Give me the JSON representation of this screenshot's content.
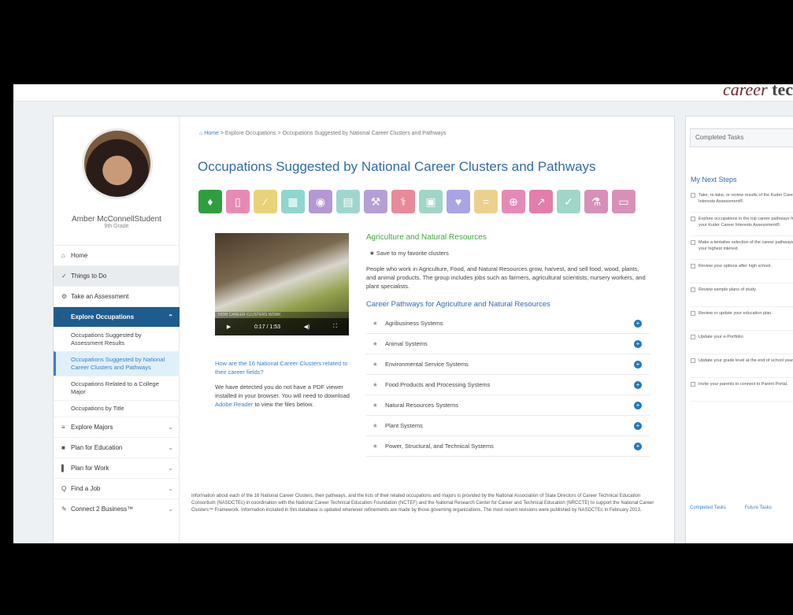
{
  "brand": {
    "career": "career",
    "rest": "tec"
  },
  "user": {
    "name": "Amber McConnellStudent",
    "grade": "9th Grade"
  },
  "nav": {
    "items": [
      {
        "icon": "⌂",
        "label": "Home",
        "style": ""
      },
      {
        "icon": "✓",
        "label": "Things to Do",
        "style": "gray"
      },
      {
        "icon": "⚙",
        "label": "Take an Assessment",
        "style": ""
      }
    ],
    "explore_occupations": {
      "label": "Explore Occupations",
      "icon": "●",
      "chevron": "⌃"
    },
    "subs": [
      {
        "label": "Occupations Suggested by Assessment Results"
      },
      {
        "label": "Occupations Suggested by National Career Clusters and Pathways"
      },
      {
        "label": "Occupations Related to a College Major"
      },
      {
        "label": "Occupations by Title"
      }
    ],
    "bottom": [
      {
        "icon": "≡",
        "label": "Explore Majors",
        "chevron": "⌄"
      },
      {
        "icon": "■",
        "label": "Plan for Education",
        "chevron": "⌄"
      },
      {
        "icon": "▌",
        "label": "Plan for Work",
        "chevron": "⌄"
      },
      {
        "icon": "Q",
        "label": "Find a Job",
        "chevron": "⌄"
      },
      {
        "icon": "✎",
        "label": "Connect 2 Business™",
        "chevron": "⌄"
      }
    ]
  },
  "breadcrumb": {
    "home": "Home",
    "sep1": ">",
    "explore": "Explore Occupations",
    "sep2": ">",
    "current": "Occupations Suggested by National Career Clusters and Pathways"
  },
  "title": "Occupations Suggested by National Career Clusters and Pathways",
  "cluster_colors": [
    "#2e9e3e",
    "#e68ab5",
    "#e9d27a",
    "#8fd6cf",
    "#b597d6",
    "#9ed6cf",
    "#b5a0d6",
    "#e88a9a",
    "#9fd6c7",
    "#a9a4e6",
    "#ecd08e",
    "#e58ab7",
    "#e47dab",
    "#9fd6c7",
    "#d88fba",
    "#d990b8"
  ],
  "cluster_glyphs": [
    "♦",
    "▯",
    "⁄",
    "▦",
    "◉",
    "▤",
    "⚒",
    "⚕",
    "▣",
    "♥",
    "=",
    "⊕",
    "↗",
    "✓",
    "⚗",
    "▭"
  ],
  "video": {
    "title": "HOW CAREER CLUSTERS WORK",
    "time": "0:17 / 1:53",
    "play": "▶",
    "volume": "◀)",
    "fullscreen": "⛶"
  },
  "video_question": "How are the 16 National Career Clusters related to their career fields?",
  "pdf_note": {
    "before": "We have detected you do not have a PDF viewer installed in your browser. You will need to download ",
    "link": "Adobe Reader",
    "after": " to view the files below."
  },
  "cluster": {
    "name": "Agriculture and Natural Resources",
    "favorite": "Save to my favorite clusters",
    "description": "People who work in Agriculture, Food, and Natural Resources grow, harvest, and sell food, wood, plants, and animal products. The group includes jobs such as farmers, agricultural scientists, nursery workers, and plant specialists.",
    "pathways_heading": "Career Pathways for Agriculture and Natural Resources",
    "pathways": [
      "Agribusiness Systems",
      "Animal Systems",
      "Environmental Service Systems",
      "Food Products and Processing Systems",
      "Natural Resources Systems",
      "Plant Systems",
      "Power, Structural, and Technical Systems"
    ]
  },
  "footer": "Information about each of the 16 National Career Clusters, their pathways, and the lists of their related occupations and majors is provided by the National Association of State Directors of Career Technical Education Consortium (NASDCTEc) in coordination with the National Career Technical Education Foundation (NCTEF) and the National Research Center for Career and Technical Education (NRCCTE) to support the National Career Clusters™ Framework. Information included in this database is updated whenever refinements are made by those governing organizations. The most recent revisions were published by NASDCTEc in February 2013.",
  "right_panel": {
    "tab": "Completed Tasks",
    "heading": "My Next Steps",
    "steps": [
      "Take, re-take, or review results of the Kuder Career Interests Assessment®.",
      "Explore occupations in the top career pathways from your Kuder Career Interests Assessment®.",
      "Make a tentative selection of the career pathways of your highest interest.",
      "Review your options after high school.",
      "Review sample plans of study.",
      "Review or update your education plan.",
      "Update your e-Portfolio.",
      "Update your grade level at the end of school year.",
      "Invite your parents to connect to Parent Portal."
    ],
    "links": [
      "Completed Tasks",
      "Future Tasks"
    ]
  }
}
